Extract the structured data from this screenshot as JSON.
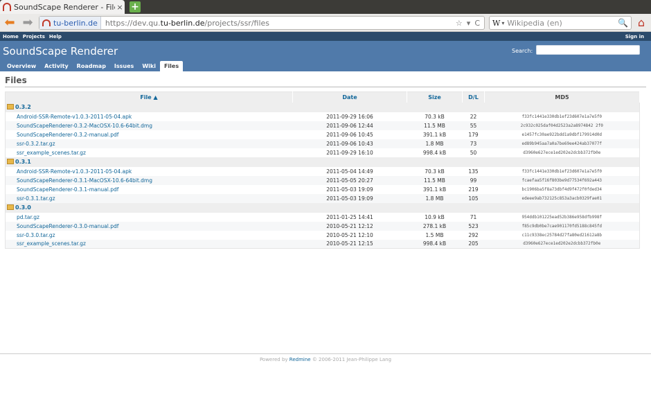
{
  "browser": {
    "tab_title": "SoundScape Renderer - Files - ...",
    "tab_close": "×",
    "new_tab": "+",
    "identity": "tu-berlin.de",
    "url_prefix": "https://dev.qu.",
    "url_domain": "tu-berlin.de",
    "url_path": "/projects/ssr/files",
    "search_engine": "W",
    "search_placeholder": "Wikipedia (en)",
    "star": "☆",
    "dropdown": "▾",
    "reload": "C"
  },
  "topmenu": {
    "home": "Home",
    "projects": "Projects",
    "help": "Help",
    "signin": "Sign in"
  },
  "header": {
    "title": "SoundScape Renderer",
    "search_label": "Search:"
  },
  "main_menu": [
    "Overview",
    "Activity",
    "Roadmap",
    "Issues",
    "Wiki",
    "Files"
  ],
  "page": {
    "title": "Files"
  },
  "table": {
    "columns": {
      "file": "File ▲",
      "date": "Date",
      "size": "Size",
      "dl": "D/L",
      "md5": "MD5"
    },
    "versions": [
      {
        "name": "0.3.2",
        "files": [
          {
            "name": "Android-SSR-Remote-v1.0.3-2011-05-04.apk",
            "date": "2011-09-29 16:06",
            "size": "70.3 kB",
            "dl": "22",
            "md5": "f33fc1441e330db1ef23d607e1a7e5f0"
          },
          {
            "name": "SoundScapeRenderer-0.3.2-MacOSX-10.6-64bit.dmg",
            "date": "2011-09-06 12:44",
            "size": "11.5 MB",
            "dl": "55",
            "md5": "2c932c025daf04d2523a2a8974842 2f0"
          },
          {
            "name": "SoundScapeRenderer-0.3.2-manual.pdf",
            "date": "2011-09-06 10:45",
            "size": "391.1 kB",
            "dl": "179",
            "md5": "e1457fc30ae922bdd1a9dbf179914d0d"
          },
          {
            "name": "ssr-0.3.2.tar.gz",
            "date": "2011-09-06 10:43",
            "size": "1.8 MB",
            "dl": "73",
            "md5": "ed89b945aa7a0a7be69ee424ab37077f"
          },
          {
            "name": "ssr_example_scenes.tar.gz",
            "date": "2011-09-29 16:10",
            "size": "998.4 kB",
            "dl": "50",
            "md5": "d3960e627ece1ed202e2dcbb372fb0e"
          }
        ]
      },
      {
        "name": "0.3.1",
        "files": [
          {
            "name": "Android-SSR-Remote-v1.0.3-2011-05-04.apk",
            "date": "2011-05-04 14:49",
            "size": "70.3 kB",
            "dl": "135",
            "md5": "f33fc1441e330db1ef23d607e1a7e5f0"
          },
          {
            "name": "SoundScapeRenderer-0.3.1-MacOSX-10.6-64bit.dmg",
            "date": "2011-05-05 20:27",
            "size": "11.5 MB",
            "dl": "99",
            "md5": "fcaefaa5f16f803be9d77534f692a443"
          },
          {
            "name": "SoundScapeRenderer-0.3.1-manual.pdf",
            "date": "2011-05-03 19:09",
            "size": "391.1 kB",
            "dl": "219",
            "md5": "bc1906ba5f8a73dbf4d9f472f0fded34"
          },
          {
            "name": "ssr-0.3.1.tar.gz",
            "date": "2011-05-03 19:09",
            "size": "1.8 MB",
            "dl": "105",
            "md5": "edeee9ab732125c853a3acb0329fae01"
          }
        ]
      },
      {
        "name": "0.3.0",
        "files": [
          {
            "name": "pd.tar.gz",
            "date": "2011-01-25 14:41",
            "size": "10.9 kB",
            "dl": "71",
            "md5": "954ddb101225ead52b386e958dfb998f"
          },
          {
            "name": "SoundScapeRenderer-0.3.0-manual.pdf",
            "date": "2010-05-21 12:12",
            "size": "278.1 kB",
            "dl": "523",
            "md5": "f85c9db0be7cae901170fd5188c845fd"
          },
          {
            "name": "ssr-0.3.0.tar.gz",
            "date": "2010-05-21 12:10",
            "size": "1.5 MB",
            "dl": "292",
            "md5": "c11c9338ec25784d27fa80ed21612a8b"
          },
          {
            "name": "ssr_example_scenes.tar.gz",
            "date": "2010-05-21 12:15",
            "size": "998.4 kB",
            "dl": "205",
            "md5": "d3960e627ece1ed202e2dcbb372fb0e"
          }
        ]
      }
    ]
  },
  "footer": {
    "powered_by": "Powered by",
    "link": "Redmine",
    "copyright": "© 2006-2011 Jean-Philippe Lang"
  }
}
